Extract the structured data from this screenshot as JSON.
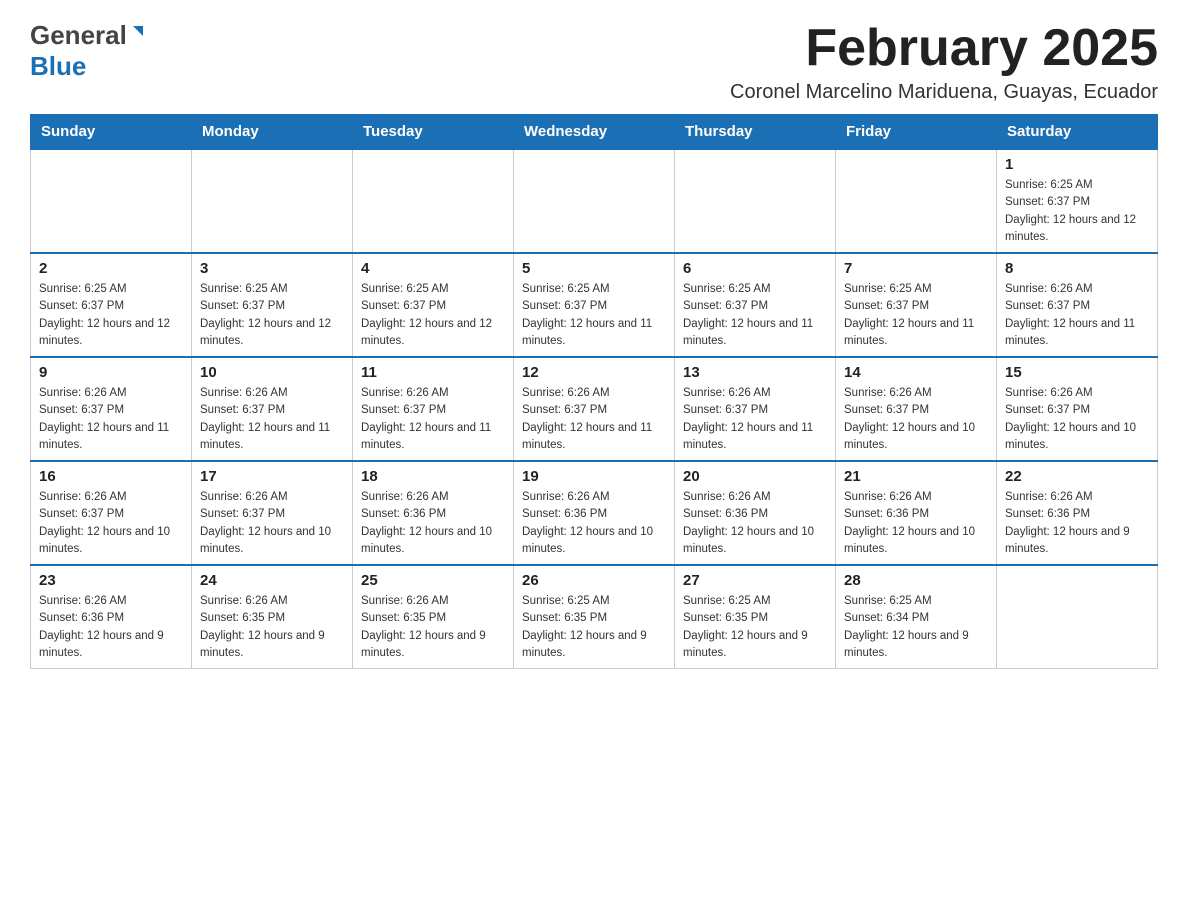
{
  "header": {
    "logo_general": "General",
    "logo_blue": "Blue",
    "month_title": "February 2025",
    "location": "Coronel Marcelino Mariduena, Guayas, Ecuador"
  },
  "weekdays": [
    "Sunday",
    "Monday",
    "Tuesday",
    "Wednesday",
    "Thursday",
    "Friday",
    "Saturday"
  ],
  "weeks": [
    [
      {
        "day": "",
        "info": ""
      },
      {
        "day": "",
        "info": ""
      },
      {
        "day": "",
        "info": ""
      },
      {
        "day": "",
        "info": ""
      },
      {
        "day": "",
        "info": ""
      },
      {
        "day": "",
        "info": ""
      },
      {
        "day": "1",
        "info": "Sunrise: 6:25 AM\nSunset: 6:37 PM\nDaylight: 12 hours and 12 minutes."
      }
    ],
    [
      {
        "day": "2",
        "info": "Sunrise: 6:25 AM\nSunset: 6:37 PM\nDaylight: 12 hours and 12 minutes."
      },
      {
        "day": "3",
        "info": "Sunrise: 6:25 AM\nSunset: 6:37 PM\nDaylight: 12 hours and 12 minutes."
      },
      {
        "day": "4",
        "info": "Sunrise: 6:25 AM\nSunset: 6:37 PM\nDaylight: 12 hours and 12 minutes."
      },
      {
        "day": "5",
        "info": "Sunrise: 6:25 AM\nSunset: 6:37 PM\nDaylight: 12 hours and 11 minutes."
      },
      {
        "day": "6",
        "info": "Sunrise: 6:25 AM\nSunset: 6:37 PM\nDaylight: 12 hours and 11 minutes."
      },
      {
        "day": "7",
        "info": "Sunrise: 6:25 AM\nSunset: 6:37 PM\nDaylight: 12 hours and 11 minutes."
      },
      {
        "day": "8",
        "info": "Sunrise: 6:26 AM\nSunset: 6:37 PM\nDaylight: 12 hours and 11 minutes."
      }
    ],
    [
      {
        "day": "9",
        "info": "Sunrise: 6:26 AM\nSunset: 6:37 PM\nDaylight: 12 hours and 11 minutes."
      },
      {
        "day": "10",
        "info": "Sunrise: 6:26 AM\nSunset: 6:37 PM\nDaylight: 12 hours and 11 minutes."
      },
      {
        "day": "11",
        "info": "Sunrise: 6:26 AM\nSunset: 6:37 PM\nDaylight: 12 hours and 11 minutes."
      },
      {
        "day": "12",
        "info": "Sunrise: 6:26 AM\nSunset: 6:37 PM\nDaylight: 12 hours and 11 minutes."
      },
      {
        "day": "13",
        "info": "Sunrise: 6:26 AM\nSunset: 6:37 PM\nDaylight: 12 hours and 11 minutes."
      },
      {
        "day": "14",
        "info": "Sunrise: 6:26 AM\nSunset: 6:37 PM\nDaylight: 12 hours and 10 minutes."
      },
      {
        "day": "15",
        "info": "Sunrise: 6:26 AM\nSunset: 6:37 PM\nDaylight: 12 hours and 10 minutes."
      }
    ],
    [
      {
        "day": "16",
        "info": "Sunrise: 6:26 AM\nSunset: 6:37 PM\nDaylight: 12 hours and 10 minutes."
      },
      {
        "day": "17",
        "info": "Sunrise: 6:26 AM\nSunset: 6:37 PM\nDaylight: 12 hours and 10 minutes."
      },
      {
        "day": "18",
        "info": "Sunrise: 6:26 AM\nSunset: 6:36 PM\nDaylight: 12 hours and 10 minutes."
      },
      {
        "day": "19",
        "info": "Sunrise: 6:26 AM\nSunset: 6:36 PM\nDaylight: 12 hours and 10 minutes."
      },
      {
        "day": "20",
        "info": "Sunrise: 6:26 AM\nSunset: 6:36 PM\nDaylight: 12 hours and 10 minutes."
      },
      {
        "day": "21",
        "info": "Sunrise: 6:26 AM\nSunset: 6:36 PM\nDaylight: 12 hours and 10 minutes."
      },
      {
        "day": "22",
        "info": "Sunrise: 6:26 AM\nSunset: 6:36 PM\nDaylight: 12 hours and 9 minutes."
      }
    ],
    [
      {
        "day": "23",
        "info": "Sunrise: 6:26 AM\nSunset: 6:36 PM\nDaylight: 12 hours and 9 minutes."
      },
      {
        "day": "24",
        "info": "Sunrise: 6:26 AM\nSunset: 6:35 PM\nDaylight: 12 hours and 9 minutes."
      },
      {
        "day": "25",
        "info": "Sunrise: 6:26 AM\nSunset: 6:35 PM\nDaylight: 12 hours and 9 minutes."
      },
      {
        "day": "26",
        "info": "Sunrise: 6:25 AM\nSunset: 6:35 PM\nDaylight: 12 hours and 9 minutes."
      },
      {
        "day": "27",
        "info": "Sunrise: 6:25 AM\nSunset: 6:35 PM\nDaylight: 12 hours and 9 minutes."
      },
      {
        "day": "28",
        "info": "Sunrise: 6:25 AM\nSunset: 6:34 PM\nDaylight: 12 hours and 9 minutes."
      },
      {
        "day": "",
        "info": ""
      }
    ]
  ]
}
